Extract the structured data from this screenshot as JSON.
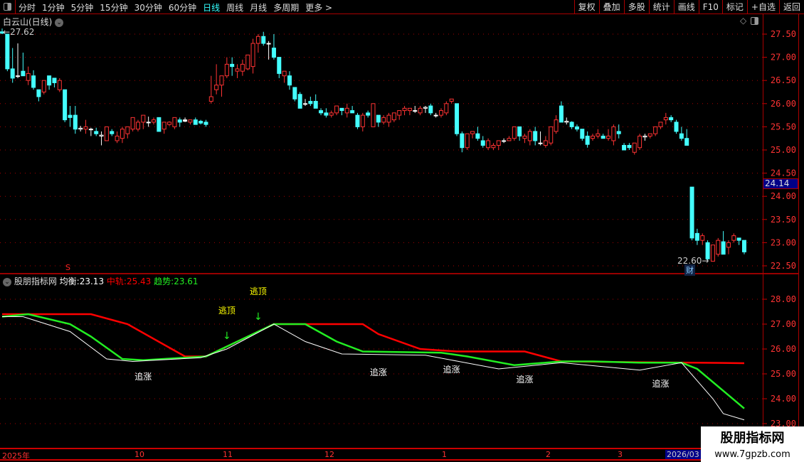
{
  "toolbar": {
    "periods": [
      "分时",
      "1分钟",
      "5分钟",
      "15分钟",
      "30分钟",
      "60分钟",
      "日线",
      "周线",
      "月线",
      "多周期",
      "更多 >"
    ],
    "active": "日线",
    "buttons": [
      "复权",
      "叠加",
      "多股",
      "统计",
      "画线",
      "F10",
      "标记",
      "+自选",
      "返回"
    ]
  },
  "main": {
    "title": "白云山(日线)",
    "high_label": "27.62",
    "low_label": "22.60",
    "cai_badge": "财",
    "s_marker": "S",
    "current_price": "24.14",
    "yticks": [
      "27.50",
      "27.00",
      "26.50",
      "26.00",
      "25.50",
      "25.00",
      "24.50",
      "24.00",
      "23.50",
      "23.00",
      "22.50"
    ],
    "ytick_values": [
      27.5,
      27.0,
      26.5,
      26.0,
      25.5,
      25.0,
      24.5,
      24.0,
      23.5,
      23.0,
      22.5
    ]
  },
  "indicator": {
    "name": "股朋指标网",
    "balance_label": "均衡:",
    "balance_value": "23.13",
    "mid_label": "中轨:",
    "mid_value": "25.43",
    "trend_label": "趋势:",
    "trend_value": "23.61",
    "yticks": [
      "28.00",
      "27.00",
      "26.00",
      "25.00",
      "24.00",
      "23.00"
    ],
    "ytick_values": [
      28,
      27,
      26,
      25,
      24,
      23
    ],
    "annotations": [
      {
        "text": "逃顶",
        "type": "top",
        "i": 43
      },
      {
        "text": "逃顶",
        "type": "top",
        "i": 49
      },
      {
        "text": "追涨",
        "type": "chase",
        "i": 27
      },
      {
        "text": "追涨",
        "type": "chase",
        "i": 72
      },
      {
        "text": "追涨",
        "type": "chase",
        "i": 86
      },
      {
        "text": "追涨",
        "type": "chase",
        "i": 100
      },
      {
        "text": "追涨",
        "type": "chase",
        "i": 126
      }
    ]
  },
  "time_axis": [
    "2025年",
    "10",
    "11",
    "12",
    "1",
    "2",
    "3",
    "2026/03"
  ],
  "watermark": {
    "name": "股朋指标网",
    "url": "www.7gpzb.com"
  },
  "colors": {
    "up": "#ff3333",
    "down": "#44ffff",
    "mid": "#ff0000",
    "trend": "#22ee22",
    "balance": "#ffffff"
  },
  "chart_data": {
    "type": "candlestick",
    "ohlc": [
      [
        27.55,
        27.62,
        27.5,
        27.52
      ],
      [
        27.5,
        27.5,
        26.7,
        26.75
      ],
      [
        26.75,
        27.2,
        26.45,
        26.55
      ],
      [
        26.6,
        27.3,
        26.55,
        26.6
      ],
      [
        26.7,
        27.1,
        26.6,
        26.6
      ],
      [
        26.5,
        26.8,
        26.4,
        26.65
      ],
      [
        26.6,
        26.72,
        26.3,
        26.35
      ],
      [
        26.3,
        26.3,
        26.05,
        26.15
      ],
      [
        26.25,
        26.5,
        26.2,
        26.5
      ],
      [
        26.6,
        26.6,
        26.3,
        26.4
      ],
      [
        26.55,
        26.55,
        26.35,
        26.45
      ],
      [
        26.3,
        26.55,
        26.25,
        26.5
      ],
      [
        26.3,
        26.3,
        25.6,
        25.65
      ],
      [
        25.75,
        25.95,
        25.5,
        25.7
      ],
      [
        25.75,
        25.95,
        25.35,
        25.45
      ],
      [
        25.45,
        25.52,
        25.4,
        25.47
      ],
      [
        25.45,
        25.65,
        25.35,
        25.5
      ],
      [
        25.45,
        25.48,
        25.3,
        25.45
      ],
      [
        25.4,
        25.48,
        25.3,
        25.35
      ],
      [
        25.3,
        25.4,
        25.1,
        25.32
      ],
      [
        25.2,
        25.5,
        25.2,
        25.5
      ],
      [
        25.4,
        25.45,
        25.3,
        25.35
      ],
      [
        25.2,
        25.4,
        25.15,
        25.3
      ],
      [
        25.25,
        25.5,
        25.15,
        25.45
      ],
      [
        25.35,
        25.5,
        25.25,
        25.5
      ],
      [
        25.45,
        25.7,
        25.4,
        25.7
      ],
      [
        25.45,
        25.65,
        25.4,
        25.6
      ],
      [
        25.6,
        25.75,
        25.45,
        25.75
      ],
      [
        25.6,
        25.72,
        25.5,
        25.6
      ],
      [
        25.6,
        25.7,
        25.55,
        25.65
      ],
      [
        25.7,
        25.7,
        25.4,
        25.4
      ],
      [
        25.45,
        25.6,
        25.35,
        25.6
      ],
      [
        25.55,
        25.62,
        25.52,
        25.6
      ],
      [
        25.5,
        25.65,
        25.45,
        25.7
      ],
      [
        25.65,
        25.7,
        25.5,
        25.6
      ],
      [
        25.65,
        25.7,
        25.6,
        25.62
      ],
      [
        25.6,
        25.65,
        25.55,
        25.65
      ],
      [
        25.65,
        25.7,
        25.55,
        25.55
      ],
      [
        25.62,
        25.65,
        25.55,
        25.58
      ],
      [
        25.6,
        25.65,
        25.5,
        25.55
      ],
      [
        26.05,
        26.6,
        26.0,
        26.15
      ],
      [
        26.3,
        26.85,
        26.2,
        26.4
      ],
      [
        26.4,
        26.5,
        26.15,
        26.6
      ],
      [
        26.6,
        27.0,
        26.55,
        26.85
      ],
      [
        26.85,
        27.0,
        26.6,
        26.8
      ],
      [
        26.7,
        26.85,
        26.55,
        26.75
      ],
      [
        26.7,
        26.95,
        26.6,
        26.85
      ],
      [
        26.75,
        27.0,
        26.72,
        27.05
      ],
      [
        26.8,
        27.4,
        26.65,
        27.3
      ],
      [
        27.3,
        27.5,
        27.1,
        27.45
      ],
      [
        27.45,
        27.55,
        27.25,
        27.3
      ],
      [
        27.3,
        27.35,
        26.95,
        27.3
      ],
      [
        27.2,
        27.5,
        26.95,
        27.0
      ],
      [
        27.0,
        27.0,
        26.55,
        26.65
      ],
      [
        26.6,
        26.7,
        26.45,
        26.7
      ],
      [
        26.6,
        26.7,
        26.3,
        26.4
      ],
      [
        26.35,
        26.35,
        26.05,
        26.1
      ],
      [
        26.2,
        26.25,
        25.9,
        25.9
      ],
      [
        26.0,
        26.1,
        25.95,
        26.0
      ],
      [
        26.05,
        26.15,
        25.95,
        26.0
      ],
      [
        26.05,
        26.2,
        25.9,
        25.9
      ],
      [
        25.85,
        25.9,
        25.75,
        25.8
      ],
      [
        25.8,
        25.9,
        25.7,
        25.75
      ],
      [
        25.75,
        25.85,
        25.7,
        25.8
      ],
      [
        25.8,
        25.9,
        25.75,
        25.95
      ],
      [
        25.9,
        25.9,
        25.75,
        25.85
      ],
      [
        25.8,
        26.0,
        25.7,
        25.9
      ],
      [
        25.85,
        25.95,
        25.8,
        25.8
      ],
      [
        25.75,
        25.8,
        25.45,
        25.5
      ],
      [
        25.5,
        25.8,
        25.4,
        25.75
      ],
      [
        25.8,
        25.85,
        25.7,
        25.75
      ],
      [
        25.5,
        26.0,
        25.5,
        26.0
      ],
      [
        25.75,
        25.75,
        25.5,
        25.6
      ],
      [
        25.6,
        25.75,
        25.55,
        25.7
      ],
      [
        25.6,
        25.8,
        25.5,
        25.75
      ],
      [
        25.65,
        25.8,
        25.6,
        25.8
      ],
      [
        25.75,
        25.85,
        25.65,
        25.85
      ],
      [
        25.85,
        25.95,
        25.75,
        25.9
      ],
      [
        25.85,
        25.9,
        25.75,
        25.9
      ],
      [
        25.85,
        25.95,
        25.8,
        25.85
      ],
      [
        25.8,
        25.95,
        25.75,
        25.9
      ],
      [
        25.9,
        25.95,
        25.8,
        25.92
      ],
      [
        25.95,
        26.0,
        25.75,
        25.8
      ],
      [
        25.75,
        25.8,
        25.7,
        25.75
      ],
      [
        25.75,
        25.9,
        25.7,
        25.85
      ],
      [
        25.8,
        26.05,
        25.75,
        26.0
      ],
      [
        26.05,
        26.1,
        26.0,
        26.1
      ],
      [
        26.0,
        26.0,
        25.3,
        25.35
      ],
      [
        25.35,
        25.4,
        24.95,
        25.05
      ],
      [
        25.05,
        25.35,
        25.0,
        25.35
      ],
      [
        25.35,
        25.4,
        25.25,
        25.4
      ],
      [
        25.35,
        25.5,
        25.2,
        25.25
      ],
      [
        25.2,
        25.3,
        25.05,
        25.1
      ],
      [
        25.05,
        25.25,
        25.0,
        25.2
      ],
      [
        25.05,
        25.15,
        25.0,
        25.1
      ],
      [
        25.1,
        25.2,
        25.0,
        25.2
      ],
      [
        25.2,
        25.25,
        25.15,
        25.2
      ],
      [
        25.2,
        25.3,
        25.2,
        25.25
      ],
      [
        25.25,
        25.5,
        25.2,
        25.5
      ],
      [
        25.5,
        25.5,
        25.2,
        25.3
      ],
      [
        25.25,
        25.35,
        25.15,
        25.3
      ],
      [
        25.2,
        25.45,
        25.1,
        25.4
      ],
      [
        25.4,
        25.5,
        25.1,
        25.2
      ],
      [
        25.15,
        25.4,
        25.1,
        25.15
      ],
      [
        25.1,
        25.3,
        25.05,
        25.2
      ],
      [
        25.15,
        25.5,
        25.1,
        25.5
      ],
      [
        25.4,
        25.75,
        25.35,
        25.65
      ],
      [
        25.95,
        26.05,
        25.6,
        25.6
      ],
      [
        25.6,
        25.7,
        25.55,
        25.62
      ],
      [
        25.6,
        25.62,
        25.45,
        25.5
      ],
      [
        25.5,
        25.55,
        25.4,
        25.45
      ],
      [
        25.45,
        25.45,
        25.2,
        25.25
      ],
      [
        25.3,
        25.4,
        25.05,
        25.12
      ],
      [
        25.25,
        25.35,
        25.2,
        25.3
      ],
      [
        25.3,
        25.45,
        25.25,
        25.35
      ],
      [
        25.3,
        25.35,
        25.25,
        25.25
      ],
      [
        25.25,
        25.45,
        25.2,
        25.3
      ],
      [
        25.2,
        25.55,
        25.1,
        25.5
      ],
      [
        25.4,
        25.55,
        25.25,
        25.35
      ],
      [
        25.1,
        25.15,
        25.0,
        25.0
      ],
      [
        25.1,
        25.15,
        25.0,
        25.05
      ],
      [
        24.95,
        25.15,
        24.9,
        25.15
      ],
      [
        25.05,
        25.35,
        25.0,
        25.3
      ],
      [
        25.28,
        25.35,
        25.2,
        25.3
      ],
      [
        25.3,
        25.35,
        25.25,
        25.35
      ],
      [
        25.35,
        25.5,
        25.3,
        25.5
      ],
      [
        25.5,
        25.6,
        25.45,
        25.6
      ],
      [
        25.65,
        25.8,
        25.55,
        25.7
      ],
      [
        25.7,
        25.75,
        25.6,
        25.65
      ],
      [
        25.6,
        25.65,
        25.35,
        25.4
      ],
      [
        25.35,
        25.5,
        25.2,
        25.25
      ],
      [
        25.25,
        25.45,
        25.1,
        25.1
      ],
      [
        24.2,
        24.2,
        23.05,
        23.1
      ],
      [
        23.2,
        23.3,
        22.95,
        23.05
      ],
      [
        23.05,
        23.2,
        22.95,
        23.15
      ],
      [
        23.0,
        23.05,
        22.6,
        22.65
      ],
      [
        22.6,
        22.95,
        22.6,
        22.95
      ],
      [
        22.75,
        23.1,
        22.7,
        23.05
      ],
      [
        23.02,
        23.25,
        22.75,
        22.75
      ],
      [
        22.9,
        23.05,
        22.75,
        23.0
      ],
      [
        23.05,
        23.2,
        23.0,
        23.15
      ],
      [
        23.1,
        23.1,
        22.95,
        23.05
      ],
      [
        23.05,
        23.05,
        22.75,
        22.8
      ]
    ],
    "price_range": [
      22.4,
      27.75
    ],
    "indicator_range": [
      22.9,
      28.6
    ],
    "series": [
      {
        "name": "中轨",
        "color": "#ff0000",
        "points": [
          [
            0,
            27.4
          ],
          [
            17,
            27.4
          ],
          [
            24,
            27.0
          ],
          [
            35,
            25.7
          ],
          [
            39,
            25.7
          ],
          [
            43,
            26.1
          ],
          [
            52,
            27.0
          ],
          [
            69,
            27.0
          ],
          [
            72,
            26.6
          ],
          [
            80,
            26.0
          ],
          [
            87,
            25.9
          ],
          [
            100,
            25.9
          ],
          [
            107,
            25.5
          ],
          [
            142,
            25.43
          ]
        ]
      },
      {
        "name": "趋势",
        "color": "#22ee22",
        "points": [
          [
            0,
            27.3
          ],
          [
            5,
            27.4
          ],
          [
            13,
            27.0
          ],
          [
            17,
            26.5
          ],
          [
            23,
            25.6
          ],
          [
            27,
            25.55
          ],
          [
            39,
            25.7
          ],
          [
            44,
            26.2
          ],
          [
            52,
            27.0
          ],
          [
            58,
            27.0
          ],
          [
            64,
            26.3
          ],
          [
            69,
            25.9
          ],
          [
            84,
            25.85
          ],
          [
            89,
            25.7
          ],
          [
            98,
            25.35
          ],
          [
            107,
            25.5
          ],
          [
            113,
            25.5
          ],
          [
            122,
            25.45
          ],
          [
            130,
            25.45
          ],
          [
            133,
            25.2
          ],
          [
            142,
            23.61
          ]
        ]
      },
      {
        "name": "均衡",
        "color": "#ffffff",
        "points": [
          [
            0,
            27.3
          ],
          [
            4,
            27.3
          ],
          [
            13,
            26.7
          ],
          [
            20,
            25.6
          ],
          [
            25,
            25.5
          ],
          [
            38,
            25.65
          ],
          [
            43,
            26.0
          ],
          [
            52,
            27.0
          ],
          [
            58,
            26.3
          ],
          [
            65,
            25.8
          ],
          [
            81,
            25.75
          ],
          [
            95,
            25.2
          ],
          [
            107,
            25.45
          ],
          [
            122,
            25.15
          ],
          [
            130,
            25.45
          ],
          [
            136,
            24.0
          ],
          [
            138,
            23.4
          ],
          [
            142,
            23.15
          ]
        ]
      }
    ]
  }
}
